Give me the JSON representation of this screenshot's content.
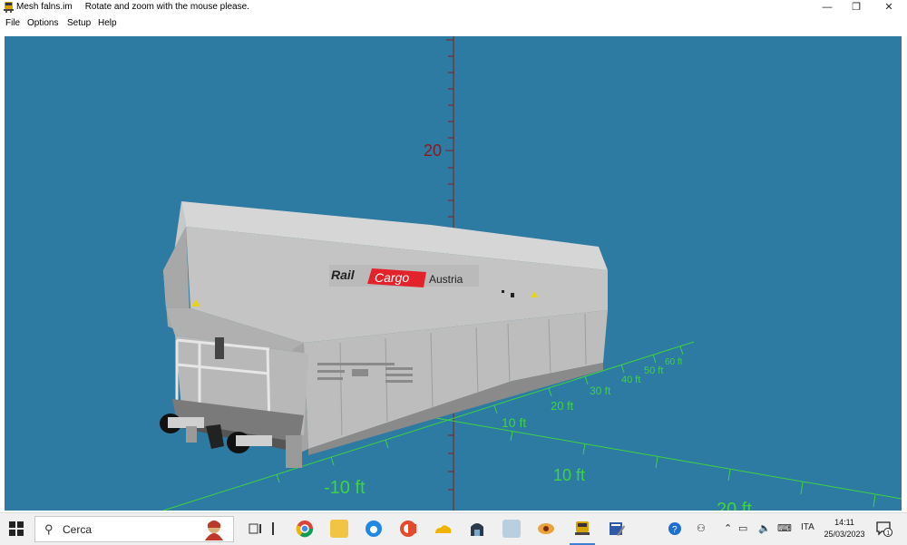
{
  "window": {
    "title": "Mesh falns.im",
    "hint": "Rotate and zoom with the mouse please.",
    "controls": {
      "minimize": "—",
      "restore": "❐",
      "close": "✕"
    }
  },
  "menu": {
    "items": [
      "File",
      "Options",
      "Setup",
      "Help"
    ]
  },
  "scene": {
    "background": "#2d7aa3",
    "vertical_axis": {
      "color": "#8b1a1a",
      "label": "20"
    },
    "floor_axis": {
      "color": "#3fd43f",
      "labels": [
        "60 ft",
        "50 ft",
        "40 ft",
        "30 ft",
        "20 ft",
        "10 ft",
        "-10 ft",
        "10 ft",
        "20 ft"
      ]
    },
    "wagon": {
      "logo_rail": "Rail",
      "logo_cargo": "Cargo",
      "logo_austria": "Austria",
      "body_color": "#b9b9b9",
      "logo_red": "#e3222b"
    }
  },
  "taskbar": {
    "search_placeholder": "Cerca",
    "search_icon": "magnifier-icon",
    "tray": {
      "language": "ITA"
    },
    "clock": {
      "time": "14:11",
      "date": "25/03/2023"
    },
    "notification_count": "1"
  }
}
